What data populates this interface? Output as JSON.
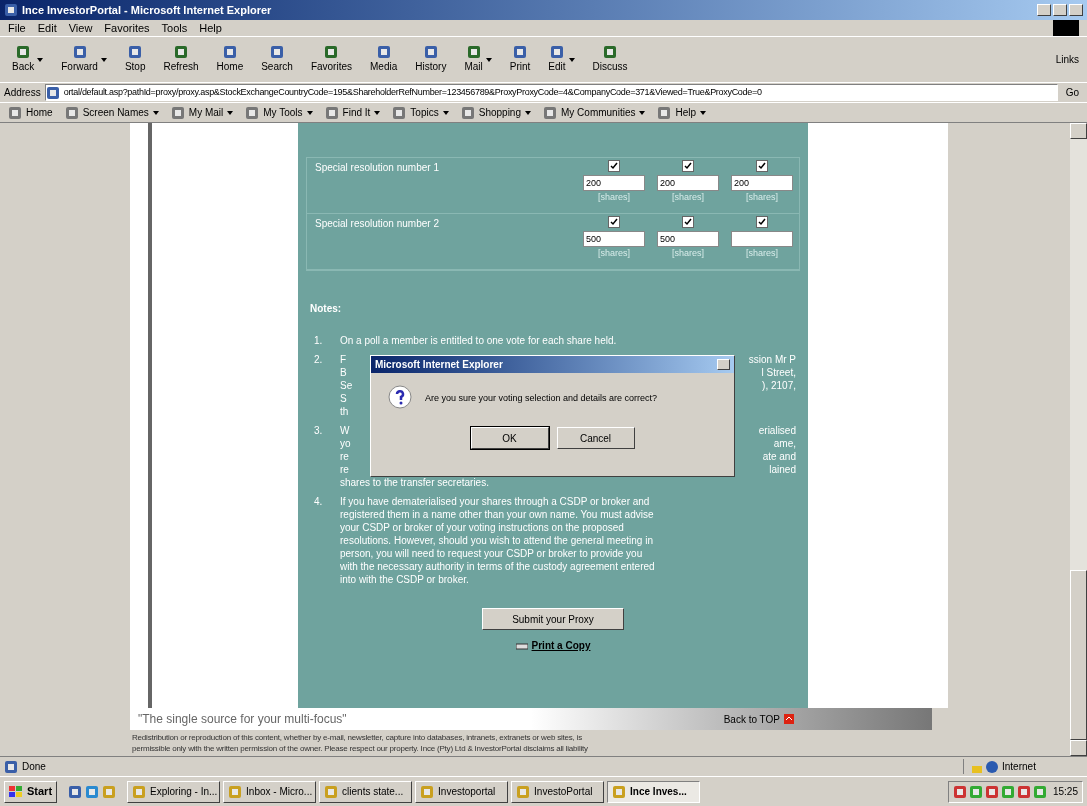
{
  "window": {
    "title": "Ince InvestorPortal - Microsoft Internet Explorer"
  },
  "menu": [
    "File",
    "Edit",
    "View",
    "Favorites",
    "Tools",
    "Help"
  ],
  "toolbar": [
    {
      "label": "Back",
      "caret": true
    },
    {
      "label": "Forward",
      "caret": true
    },
    {
      "label": "Stop",
      "caret": false
    },
    {
      "label": "Refresh",
      "caret": false
    },
    {
      "label": "Home",
      "caret": false
    },
    {
      "label": "Search",
      "caret": false
    },
    {
      "label": "Favorites",
      "caret": false
    },
    {
      "label": "Media",
      "caret": false
    },
    {
      "label": "History",
      "caret": false
    },
    {
      "label": "Mail",
      "caret": true
    },
    {
      "label": "Print",
      "caret": false
    },
    {
      "label": "Edit",
      "caret": true
    },
    {
      "label": "Discuss",
      "caret": false
    }
  ],
  "links_label": "Links",
  "address": {
    "label": "Address",
    "value": "ortal/default.asp?pathId=proxy/proxy.asp&StockExchangeCountryCode=195&ShareholderRefNumber=123456789&ProxyProxyCode=4&CompanyCode=371&Viewed=True&ProxyCode=0",
    "go": "Go"
  },
  "links_bar": [
    {
      "label": "Home",
      "caret": false
    },
    {
      "label": "Screen Names",
      "caret": true
    },
    {
      "label": "My Mail",
      "caret": true
    },
    {
      "label": "My Tools",
      "caret": true
    },
    {
      "label": "Find It",
      "caret": true
    },
    {
      "label": "Topics",
      "caret": true
    },
    {
      "label": "Shopping",
      "caret": true
    },
    {
      "label": "My Communities",
      "caret": true
    },
    {
      "label": "Help",
      "caret": true
    }
  ],
  "resolutions": [
    {
      "label": "Special resolution number 1",
      "cells": [
        {
          "checked": true,
          "value": "200",
          "unit": "[shares]"
        },
        {
          "checked": true,
          "value": "200",
          "unit": "[shares]"
        },
        {
          "checked": true,
          "value": "200",
          "unit": "[shares]"
        }
      ]
    },
    {
      "label": "Special resolution number 2",
      "cells": [
        {
          "checked": true,
          "value": "500",
          "unit": "[shares]"
        },
        {
          "checked": true,
          "value": "500",
          "unit": "[shares]"
        },
        {
          "checked": true,
          "unit": "[shares]"
        }
      ]
    }
  ],
  "notes": {
    "heading": "Notes:",
    "items": [
      {
        "number": "1.",
        "lines": [
          {
            "text": "On a poll a member is entitled to one vote for each share held."
          }
        ]
      },
      {
        "number": "2.",
        "lines": [
          {
            "left": "F",
            "right": "ssion Mr P"
          },
          {
            "left": "B",
            "right": "l Street,"
          },
          {
            "left": "Se",
            "right": "), 2107,"
          },
          {
            "left": "S"
          },
          {
            "left": "th"
          }
        ]
      },
      {
        "number": "3.",
        "lines": [
          {
            "left": "W",
            "right": "erialised"
          },
          {
            "left": "yo",
            "right": "ame,"
          },
          {
            "left": "re",
            "right": "ate and"
          },
          {
            "left": "re",
            "right": "lained"
          },
          {
            "text": "shares to the transfer secretaries."
          }
        ]
      },
      {
        "number": "4.",
        "lines": [
          {
            "text": "If you have dematerialised your shares through a CSDP or broker and"
          },
          {
            "text": "registered them in a name other than your own name. You must advise"
          },
          {
            "text": "your CSDP or broker of your voting instructions on the proposed"
          },
          {
            "text": "resolutions. However, should you wish to attend the general meeting in"
          },
          {
            "text": "person, you will need to request your CSDP or broker to provide you"
          },
          {
            "text": "with the necessary authority in terms of the custody agreement entered"
          },
          {
            "text": "into with the CSDP or broker."
          }
        ]
      }
    ]
  },
  "submit": "Submit your Proxy",
  "print_link": "Print a Copy",
  "footer": {
    "tagline": "\"The single source for your multi-focus\"",
    "back_to_top": "Back to TOP",
    "legal": [
      "Redistribution or reproduction of this content, whether by e-mail, newsletter, capture into databases, intranets, extranets or web sites, is",
      "permissible only with the written permission of the owner. Please respect our property. Ince (Pty) Ltd & InvestorPortal disclaims all liability"
    ]
  },
  "dialog": {
    "title": "Microsoft Internet Explorer",
    "message": "Are you sure your voting selection and details are correct?",
    "buttons": [
      {
        "label": "OK",
        "selected": true
      },
      {
        "label": "Cancel",
        "selected": false
      }
    ]
  },
  "status_bar": {
    "text": "Done",
    "zone": "Internet"
  },
  "taskbar": {
    "start": "Start",
    "tasks": [
      {
        "label": "Exploring - In...",
        "selected": false
      },
      {
        "label": "Inbox - Micro...",
        "selected": false
      },
      {
        "label": "clients  state...",
        "selected": false
      },
      {
        "label": "Investoportal",
        "selected": false
      },
      {
        "label": "InvestoPortal",
        "selected": false
      },
      {
        "label": "Ince Inves...",
        "selected": true
      }
    ],
    "clock": "15:25"
  }
}
